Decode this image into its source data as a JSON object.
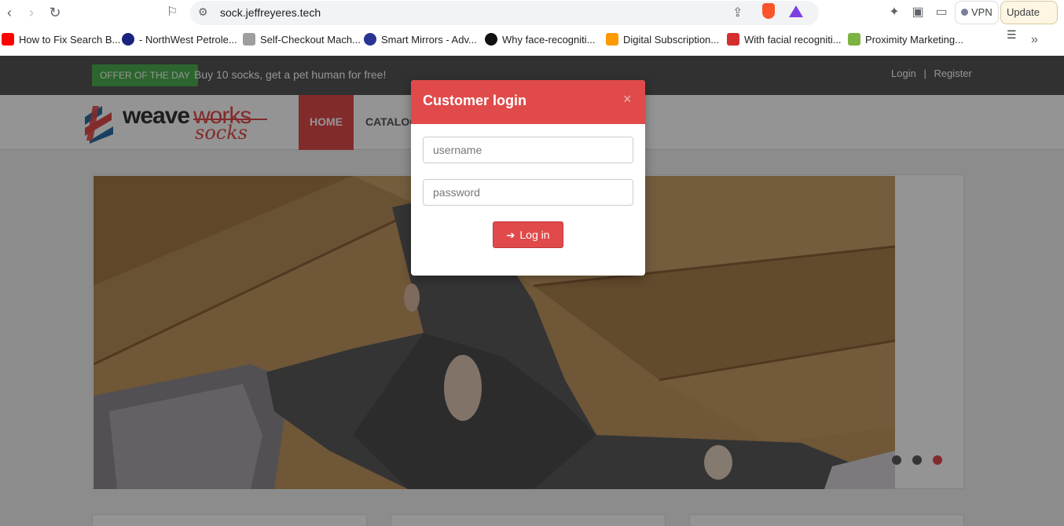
{
  "browser": {
    "url": "sock.jeffreyeres.tech",
    "vpn_label": "VPN",
    "update_label": "Update",
    "bookmarks": [
      {
        "label": "How to Fix Search B...",
        "icon": "youtube-icon",
        "color": "#ff0000"
      },
      {
        "label": "- NorthWest Petrole...",
        "icon": "globe-dark-icon",
        "color": "#1a237e"
      },
      {
        "label": "Self-Checkout Mach...",
        "icon": "page-icon",
        "color": "#9e9e9e"
      },
      {
        "label": "Smart Mirrors - Adv...",
        "icon": "t-badge-icon",
        "color": "#283593"
      },
      {
        "label": "Why face-recogniti...",
        "icon": "circle-logo-icon",
        "color": "#111111"
      },
      {
        "label": "Digital Subscription...",
        "icon": "amazon-icon",
        "color": "#ff9900"
      },
      {
        "label": "With facial recogniti...",
        "icon": "cnet-icon",
        "color": "#d32f2f"
      },
      {
        "label": "Proximity Marketing...",
        "icon": "shopify-icon",
        "color": "#7cb342"
      }
    ]
  },
  "site": {
    "offer_badge": "OFFER OF THE DAY",
    "offer_text": "Buy 10 socks, get a pet human for free!",
    "login_link": "Login",
    "separator": "|",
    "register_link": "Register",
    "logo_word1": "weave",
    "logo_word2": "works",
    "logo_word3": "socks",
    "nav_home": "HOME",
    "nav_catalog": "CATALOG",
    "accent_color": "#e04a4a"
  },
  "modal": {
    "title": "Customer login",
    "close_glyph": "×",
    "username_placeholder": "username",
    "password_placeholder": "password",
    "login_button": "Log in"
  }
}
